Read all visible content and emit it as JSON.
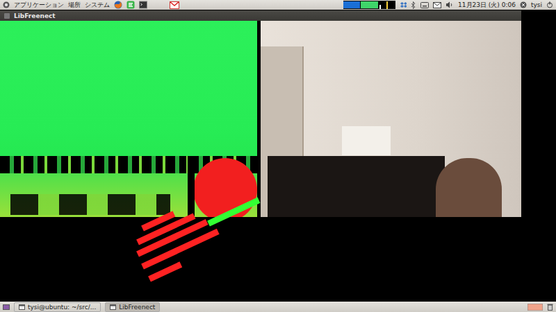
{
  "top_panel": {
    "menus": [
      "アプリケーション",
      "場所",
      "システム"
    ],
    "clock": "11月23日 (火) 0:06",
    "user": "tysi"
  },
  "window": {
    "title": "LibFreenect"
  },
  "taskbar": [
    {
      "label": "tysi@ubuntu: ~/src/...",
      "selected": false
    },
    {
      "label": "LibFreenect",
      "selected": true
    }
  ]
}
